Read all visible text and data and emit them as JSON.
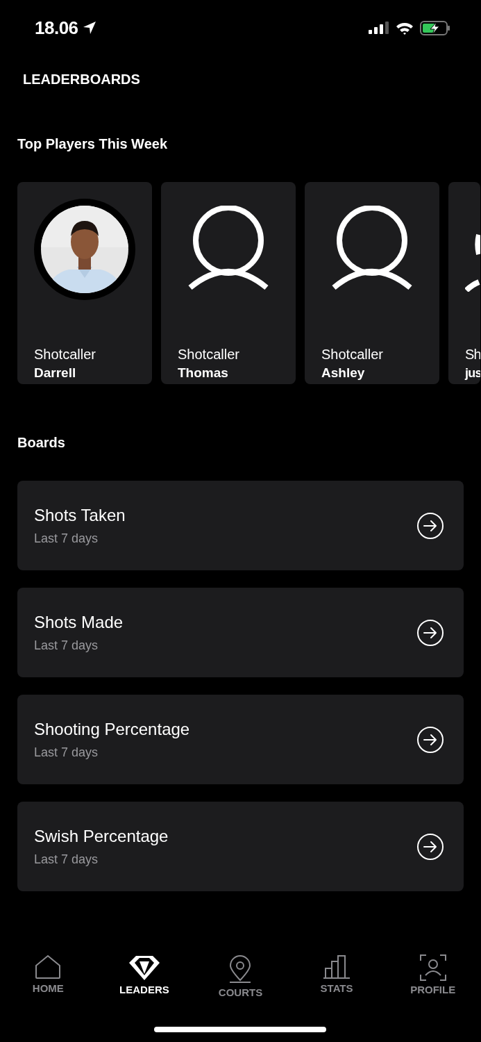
{
  "status_bar": {
    "time": "18.06"
  },
  "header": {
    "title": "LEADERBOARDS"
  },
  "top_players": {
    "heading": "Top Players This Week",
    "players": [
      {
        "line_1": "Shotcaller",
        "line_2": "Darrell"
      },
      {
        "kind": "generic",
        "line_1": "Shotcaller",
        "line_2": "Thomas"
      },
      {
        "kind": "generic",
        "line_1": "Shotcaller",
        "line_2": "Ashley"
      },
      {
        "kind": "partial",
        "line_1": "Sh",
        "line_2": "jus"
      }
    ]
  },
  "boards": {
    "heading": "Boards",
    "items": [
      {
        "title": "Shots Taken",
        "subtitle": "Last 7 days"
      },
      {
        "title": "Shots Made",
        "subtitle": "Last 7 days"
      },
      {
        "title": "Shooting Percentage",
        "subtitle": "Last 7 days"
      },
      {
        "title": "Swish Percentage",
        "subtitle": "Last 7 days"
      }
    ]
  },
  "tab_bar": [
    {
      "label": "HOME",
      "selected": false
    },
    {
      "label": "LEADERS",
      "selected": true
    },
    {
      "label": "COURTS",
      "selected": false
    },
    {
      "label": "STATS",
      "selected": false
    },
    {
      "label": "PROFILE",
      "selected": false
    }
  ]
}
